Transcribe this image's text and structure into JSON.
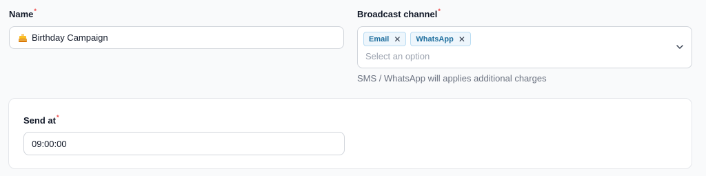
{
  "name_field": {
    "label": "Name",
    "required_mark": "*",
    "value": "Birthday Campaign",
    "icon": "cake-icon"
  },
  "broadcast_field": {
    "label": "Broadcast channel",
    "required_mark": "*",
    "selected": [
      {
        "label": "Email",
        "remove": "✕"
      },
      {
        "label": "WhatsApp",
        "remove": "✕"
      }
    ],
    "placeholder": "Select an option",
    "helper": "SMS / WhatsApp will applies additional charges",
    "dropdown_icon": "chevron-down-icon"
  },
  "send_at_field": {
    "label": "Send at",
    "required_mark": "*",
    "value": "09:00:00"
  },
  "colors": {
    "required": "#ef4444",
    "chip_bg": "#eef6fc",
    "chip_border": "#b9dcf2",
    "chip_text": "#1f6f9e"
  }
}
